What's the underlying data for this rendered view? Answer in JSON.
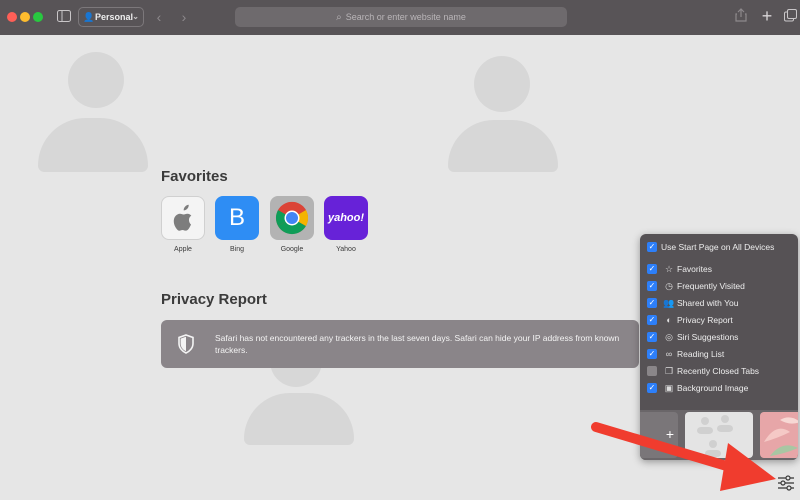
{
  "toolbar": {
    "profile_label": "Personal",
    "url_placeholder": "Search or enter website name"
  },
  "favorites": {
    "title": "Favorites",
    "items": [
      {
        "label": "Apple",
        "icon": "apple-logo-icon"
      },
      {
        "label": "Bing",
        "glyph": "B"
      },
      {
        "label": "Google",
        "icon": "chrome-logo-icon"
      },
      {
        "label": "Yahoo",
        "glyph": "yahoo!"
      }
    ]
  },
  "privacy": {
    "title": "Privacy Report",
    "message": "Safari has not encountered any trackers in the last seven days. Safari can hide your IP address from known trackers."
  },
  "customize": {
    "items": [
      {
        "label": "Use Start Page on All Devices",
        "checked": true
      },
      {
        "label": "Favorites",
        "checked": true,
        "icon": "star-icon"
      },
      {
        "label": "Frequently Visited",
        "checked": true,
        "icon": "clock-icon"
      },
      {
        "label": "Shared with You",
        "checked": true,
        "icon": "people-icon"
      },
      {
        "label": "Privacy Report",
        "checked": true,
        "icon": "shield-icon"
      },
      {
        "label": "Siri Suggestions",
        "checked": true,
        "icon": "siri-icon"
      },
      {
        "label": "Reading List",
        "checked": true,
        "icon": "glasses-icon"
      },
      {
        "label": "Recently Closed Tabs",
        "checked": false,
        "icon": "tabs-icon"
      },
      {
        "label": "Background Image",
        "checked": true,
        "icon": "image-icon"
      }
    ],
    "thumb_add_glyph": "+"
  },
  "colors": {
    "toolbar": "#585457",
    "page_background": "#e6e6e6",
    "checkbox_accent": "#2d7ff9",
    "annotation_arrow": "#f03c2e"
  }
}
